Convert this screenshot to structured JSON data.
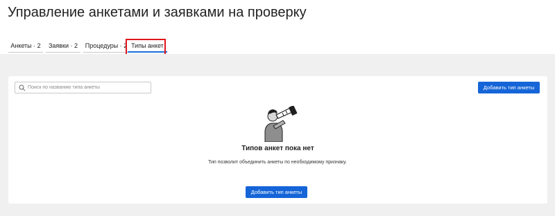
{
  "page": {
    "title": "Управление анкетами и заявками на проверку"
  },
  "tabs": [
    {
      "label": "Анкеты · 2",
      "active": false
    },
    {
      "label": "Заявки · 2",
      "active": false
    },
    {
      "label": "Процедуры · 2",
      "active": false
    },
    {
      "label": "Типы анкет",
      "active": true
    }
  ],
  "search": {
    "placeholder": "Поиск по названию типа анкеты",
    "icon": "search-icon"
  },
  "toolbar": {
    "add_label": "Добавить тип анкеты"
  },
  "empty_state": {
    "illustration": "person-with-telescope",
    "title": "Типов анкет пока нет",
    "description": "Тип позволит объединить анкеты по необходимому признаку.",
    "button_label": "Добавить тип анкеты"
  },
  "colors": {
    "accent": "#1565d8",
    "highlight": "#e0141b",
    "background": "#f0f0f0"
  }
}
